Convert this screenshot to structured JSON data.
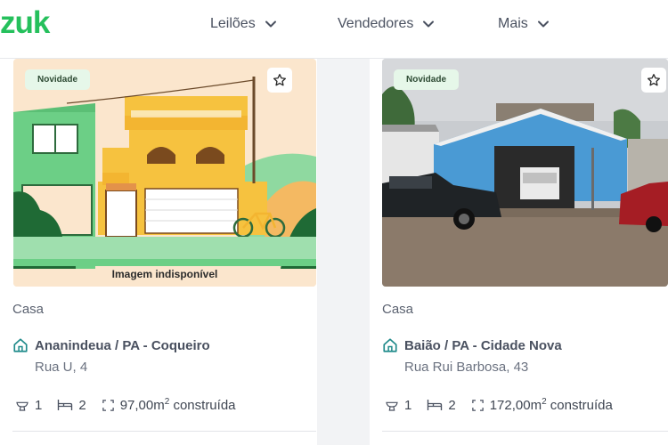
{
  "header": {
    "logo": "zuk",
    "nav": [
      {
        "label": "Leilões"
      },
      {
        "label": "Vendedores"
      },
      {
        "label": "Mais"
      }
    ]
  },
  "colors": {
    "brand": "#25c05c",
    "badge_bg": "#e6f7e9",
    "text": "#4a5160"
  },
  "cards": [
    {
      "badge": "Novidade",
      "image_caption": "Imagem indisponível",
      "type": "Casa",
      "city": "Ananindeua / PA - Coqueiro",
      "street": "Rua U, 4",
      "bathrooms": "1",
      "bedrooms": "2",
      "area_value": "97,00m",
      "area_sup": "2",
      "area_suffix": " construída"
    },
    {
      "badge": "Novidade",
      "type": "Casa",
      "city": "Baião / PA - Cidade Nova",
      "street": "Rua Rui Barbosa, 43",
      "bathrooms": "1",
      "bedrooms": "2",
      "area_value": "172,00m",
      "area_sup": "2",
      "area_suffix": " construída"
    }
  ],
  "icons": {
    "favorite": "star-icon",
    "location": "home-icon",
    "bathroom": "toilet-icon",
    "bedroom": "bed-icon",
    "area": "area-icon",
    "dropdown": "chevron-down-icon"
  }
}
